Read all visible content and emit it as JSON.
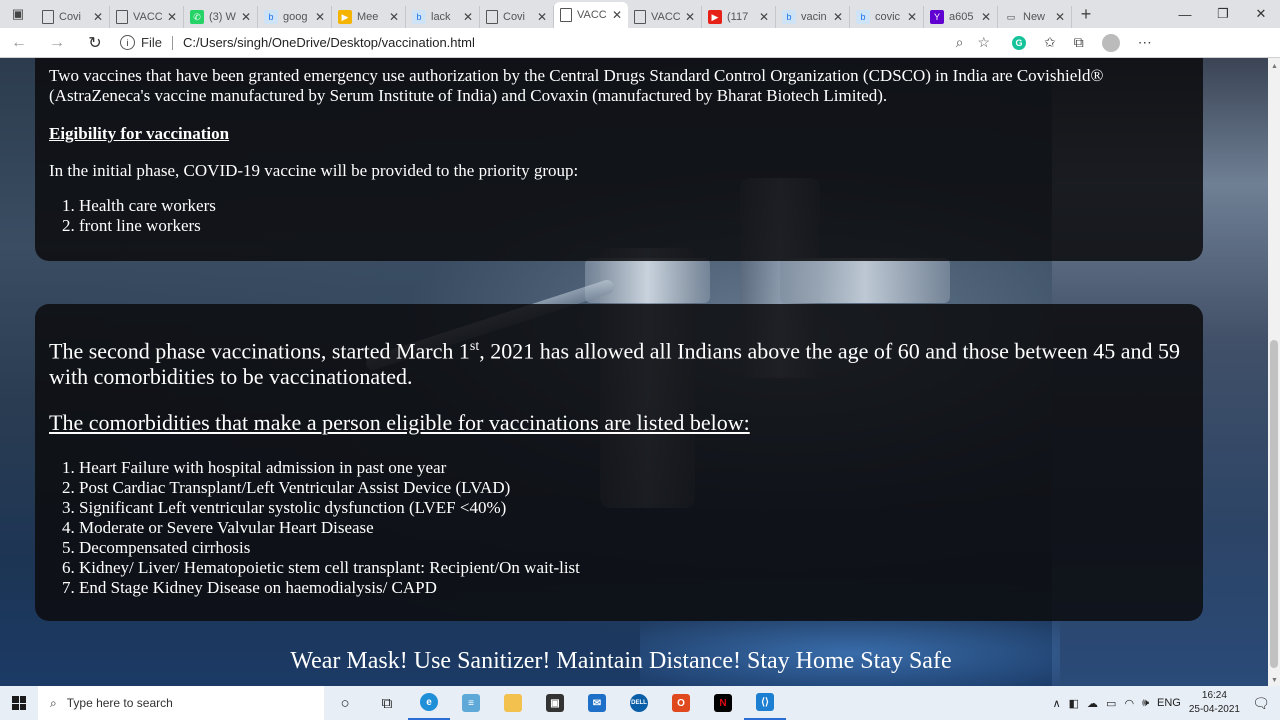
{
  "browser": {
    "tabs": [
      {
        "label": "Covi",
        "favicon": "doc-icon",
        "active": false
      },
      {
        "label": "VACC",
        "favicon": "doc-icon",
        "active": false
      },
      {
        "label": "(3) W",
        "favicon": "whatsapp-icon",
        "active": false
      },
      {
        "label": "goog",
        "favicon": "bing-icon",
        "active": false
      },
      {
        "label": "Mee",
        "favicon": "meet-icon",
        "active": false
      },
      {
        "label": "lack",
        "favicon": "bing-icon",
        "active": false
      },
      {
        "label": "Covi",
        "favicon": "doc-icon",
        "active": false
      },
      {
        "label": "VACC",
        "favicon": "doc-icon",
        "active": true
      },
      {
        "label": "VACC",
        "favicon": "doc-icon",
        "active": false
      },
      {
        "label": "(117",
        "favicon": "youtube-icon",
        "active": false
      },
      {
        "label": "vacin",
        "favicon": "bing-icon",
        "active": false
      },
      {
        "label": "covic",
        "favicon": "bing-icon",
        "active": false
      },
      {
        "label": "a605",
        "favicon": "yahoo-icon",
        "active": false
      },
      {
        "label": "New",
        "favicon": "newtab-icon",
        "active": false
      }
    ],
    "address": {
      "scheme_label": "File",
      "url": "C:/Users/singh/OneDrive/Desktop/vaccination.html"
    }
  },
  "page": {
    "intro": "Two vaccines that have been granted emergency use authorization by the Central Drugs Standard Control Organization (CDSCO) in India are Covishield® (AstraZeneca's vaccine manufactured by Serum Institute of India) and Covaxin (manufactured by Bharat Biotech Limited).",
    "eligibility_heading": "Eigibility for vaccination",
    "initial_phase": "In the initial phase, COVID-19 vaccine will be provided to the priority group:",
    "priority_groups": [
      "Health care workers",
      "front line workers"
    ],
    "second_phase": {
      "before": "The second phase vaccinations, started March 1",
      "sup": "st",
      "after": ", 2021 has allowed all Indians above the age of 60 and those between 45 and 59 with comorbidities to be vaccinationated."
    },
    "comorbidities_heading": "The comorbidities that make a person eligible for vaccinations are listed below:",
    "comorbidities": [
      "Heart Failure with hospital admission in past one year",
      "Post Cardiac Transplant/Left Ventricular Assist Device (LVAD)",
      "Significant Left ventricular systolic dysfunction (LVEF <40%)",
      "Moderate or Severe Valvular Heart Disease",
      "Decompensated cirrhosis",
      "Kidney/ Liver/ Hematopoietic stem cell transplant: Recipient/On wait-list",
      "End Stage Kidney Disease on haemodialysis/ CAPD"
    ],
    "slogan": "Wear Mask! Use Sanitizer! Maintain Distance! Stay Home Stay Safe"
  },
  "taskbar": {
    "search_placeholder": "Type here to search",
    "language": "ENG",
    "time": "16:24",
    "date": "25-04-2021"
  }
}
